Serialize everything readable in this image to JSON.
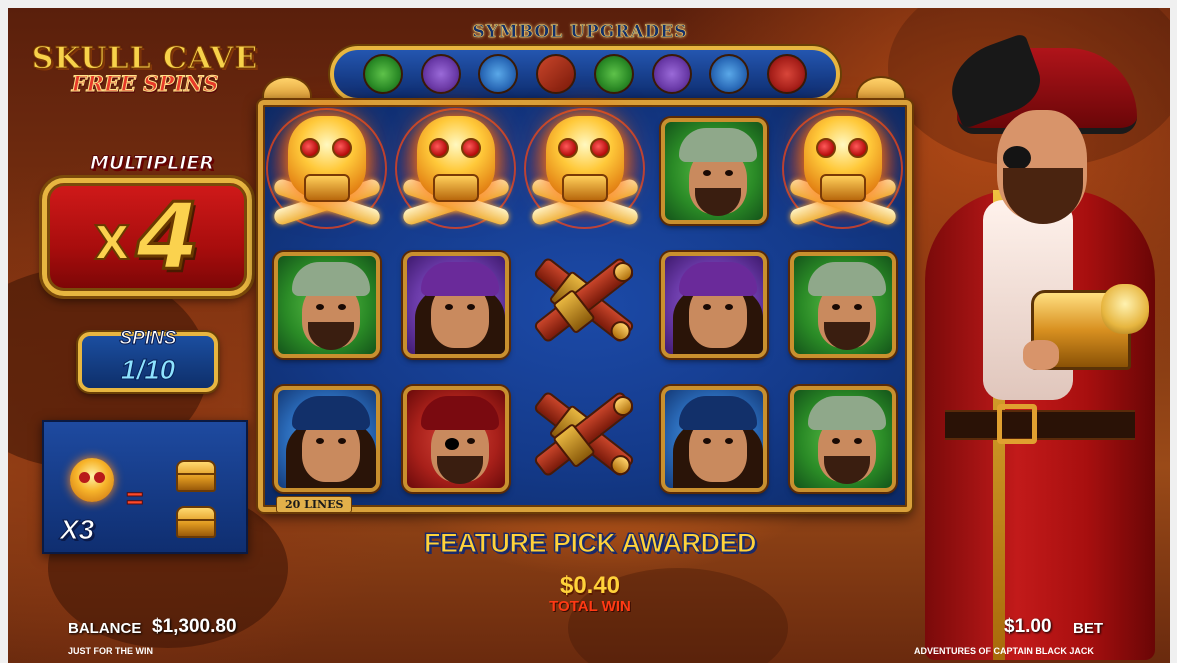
{
  "game": {
    "title_line1": "SKULL CAVE",
    "title_line2": "FREE SPINS"
  },
  "multiplier": {
    "label": "MULTIPLIER",
    "prefix": "X",
    "value": "4"
  },
  "spins": {
    "label": "SPINS",
    "value": "1/10"
  },
  "collect_info": {
    "count": "X3",
    "equals": "=",
    "icons": [
      "gold-skull-icon",
      "treasure-chest-icon",
      "treasure-chest-icon"
    ]
  },
  "symbol_upgrades": {
    "title": "SYMBOL UPGRADES",
    "icons": [
      "green-pirate-icon",
      "purple-pirate-icon",
      "blue-pirate-icon",
      "pistols-icon",
      "green-pirate-icon",
      "purple-pirate-icon",
      "blue-pirate-icon",
      "captain-icon"
    ]
  },
  "reels": {
    "lines_label": "20 LINES",
    "rows": [
      [
        "skull",
        "skull",
        "skull",
        "green-pirate",
        "skull"
      ],
      [
        "green-pirate",
        "purple-pirate",
        "pistols",
        "purple-pirate",
        "green-pirate"
      ],
      [
        "blue-pirate",
        "captain",
        "pistols",
        "blue-pirate",
        "green-pirate"
      ]
    ]
  },
  "messages": {
    "feature": "FEATURE PICK AWARDED",
    "win_amount": "$0.40",
    "win_label": "TOTAL WIN"
  },
  "footer": {
    "balance_label": "BALANCE",
    "balance_value": "$1,300.80",
    "bet_value": "$1.00",
    "bet_label": "BET",
    "left_caption": "JUST FOR THE WIN",
    "right_caption": "ADVENTURES OF CAPTAIN BLACK JACK"
  },
  "colors": {
    "gold": "#e7b640",
    "reel_blue": "#143a8a",
    "multiplier_red": "#a80d0d",
    "win_red": "#ff3a14"
  }
}
